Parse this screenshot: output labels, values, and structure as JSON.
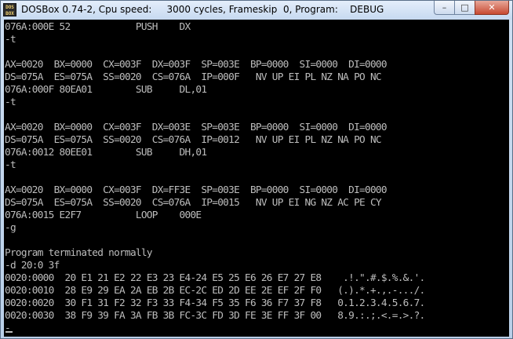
{
  "window": {
    "title": "DOSBox 0.74-2, Cpu speed:     3000 cycles, Frameskip  0, Program:    DEBUG",
    "icon_text": "DOS BOX",
    "controls": {
      "minimize": "–",
      "maximize": "□",
      "close": "✕"
    }
  },
  "console": {
    "lines": [
      "076A:000E 52            PUSH    DX",
      "-t",
      "",
      "AX=0020  BX=0000  CX=003F  DX=003F  SP=003E  BP=0000  SI=0000  DI=0000",
      "DS=075A  ES=075A  SS=0020  CS=076A  IP=000F   NV UP EI PL NZ NA PO NC",
      "076A:000F 80EA01        SUB     DL,01",
      "-t",
      "",
      "AX=0020  BX=0000  CX=003F  DX=003E  SP=003E  BP=0000  SI=0000  DI=0000",
      "DS=075A  ES=075A  SS=0020  CS=076A  IP=0012   NV UP EI PL NZ NA PO NC",
      "076A:0012 80EE01        SUB     DH,01",
      "-t",
      "",
      "AX=0020  BX=0000  CX=003F  DX=FF3E  SP=003E  BP=0000  SI=0000  DI=0000",
      "DS=075A  ES=075A  SS=0020  CS=076A  IP=0015   NV UP EI NG NZ AC PE CY",
      "076A:0015 E2F7          LOOP    000E",
      "-g",
      "",
      "Program terminated normally",
      "-d 20:0 3f",
      "0020:0000  20 E1 21 E2 22 E3 23 E4-24 E5 25 E6 26 E7 27 E8    .!.\".#.$.%.&.'.",
      "0020:0010  28 E9 29 EA 2A EB 2B EC-2C ED 2D EE 2E EF 2F F0   (.).*.+.,.-.../.",
      "0020:0020  30 F1 31 F2 32 F3 33 F4-34 F5 35 F6 36 F7 37 F8   0.1.2.3.4.5.6.7.",
      "0020:0030  38 F9 39 FA 3A FB 3B FC-3C FD 3D FE 3E FF 3F 00   8.9.:.;.<.=.>.?.",
      "-"
    ]
  }
}
